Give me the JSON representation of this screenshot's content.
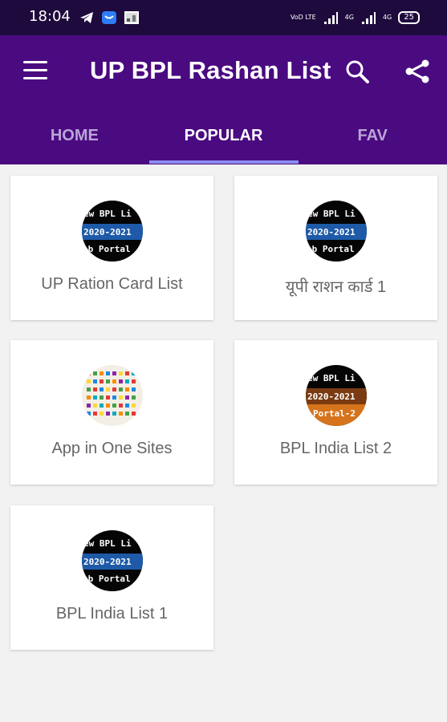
{
  "status_bar": {
    "time": "18:04",
    "network_labels": [
      "VoD LTE",
      "4G",
      "4G"
    ],
    "battery": "25"
  },
  "app_bar": {
    "title": "UP BPL Rashan List",
    "icons": [
      "menu-icon",
      "search-icon",
      "share-icon"
    ]
  },
  "tabs": [
    {
      "label": "HOME",
      "active": false
    },
    {
      "label": "POPULAR",
      "active": true
    },
    {
      "label": "FAV",
      "active": false
    }
  ],
  "cards": [
    {
      "label": "UP Ration Card List",
      "thumb_lines": [
        "ew BPL Li",
        "2020-2021",
        "eb Portal"
      ],
      "accent": "#1e5aa8"
    },
    {
      "label": "यूपी राशन कार्ड 1",
      "thumb_lines": [
        "ew BPL Li",
        "2020-2021",
        "eb Portal"
      ],
      "accent": "#1e5aa8"
    },
    {
      "label": "App in One Sites",
      "thumb_lines": [],
      "accent": "#f1eadf"
    },
    {
      "label": "BPL India List 2",
      "thumb_lines": [
        "ew BPL Li",
        "2020-2021",
        "Portal-2"
      ],
      "accent": "#d5741c"
    },
    {
      "label": "BPL India List 1",
      "thumb_lines": [
        "ew BPL Li",
        "2020-2021",
        "eb Portal"
      ],
      "accent": "#1e5aa8"
    }
  ],
  "colors": {
    "status_bar": "#1e0a3c",
    "app_bar": "#4a0a80",
    "tab_indicator": "#8c8cf0",
    "background": "#f2f2f2"
  }
}
